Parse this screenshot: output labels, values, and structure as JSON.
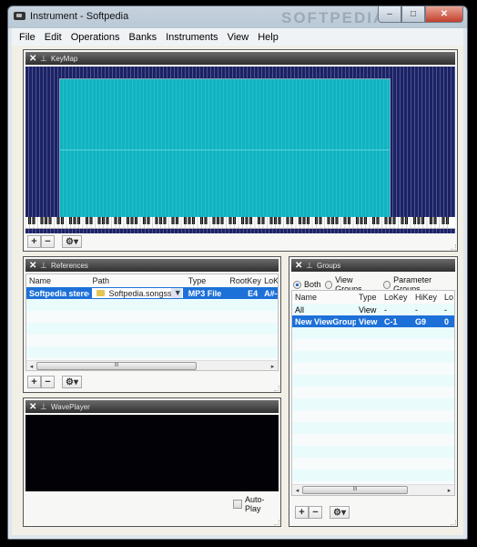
{
  "window": {
    "title": "Instrument - Softpedia",
    "watermark": "SOFTPEDIA",
    "buttons": {
      "minimize": "–",
      "maximize": "□",
      "close": "✕"
    }
  },
  "menubar": {
    "items": [
      "File",
      "Edit",
      "Operations",
      "Banks",
      "Instruments",
      "View",
      "Help"
    ]
  },
  "panel_controls": {
    "close_glyph": "✕",
    "pin_glyph": "⊥"
  },
  "keymap": {
    "title": "KeyMap",
    "tools": {
      "add": "+",
      "remove": "−",
      "options": "⚙▾"
    }
  },
  "references": {
    "title": "References",
    "columns": [
      "Name",
      "Path",
      "Type",
      "RootKey",
      "LoK"
    ],
    "rows": [
      {
        "name": "Softpedia stereo",
        "path": "Softpedia.songss",
        "type": "MP3 File",
        "rootkey": "E4",
        "lokey": "A#-"
      }
    ],
    "scroll": {
      "left": "◂",
      "right": "▸",
      "thumb": "III"
    },
    "tools": {
      "add": "+",
      "remove": "−",
      "options": "⚙▾"
    }
  },
  "groups": {
    "title": "Groups",
    "filters": [
      {
        "label": "Both",
        "selected": true
      },
      {
        "label": "View Groups",
        "selected": false
      },
      {
        "label": "Parameter Groups",
        "selected": false
      }
    ],
    "columns": [
      "Name",
      "Type",
      "LoKey",
      "HiKey",
      "Lo"
    ],
    "rows": [
      {
        "name": "All",
        "type": "View",
        "lokey": "-",
        "hikey": "-",
        "lo": "-"
      },
      {
        "name": "New ViewGroup",
        "type": "View",
        "lokey": "C-1",
        "hikey": "G9",
        "lo": "0"
      }
    ],
    "scroll": {
      "left": "◂",
      "right": "▸",
      "thumb": "III"
    },
    "tools": {
      "add": "+",
      "remove": "−",
      "options": "⚙▾"
    }
  },
  "waveplayer": {
    "title": "WavePlayer",
    "autoplay_label": "Auto-Play",
    "autoplay_checked": false
  }
}
